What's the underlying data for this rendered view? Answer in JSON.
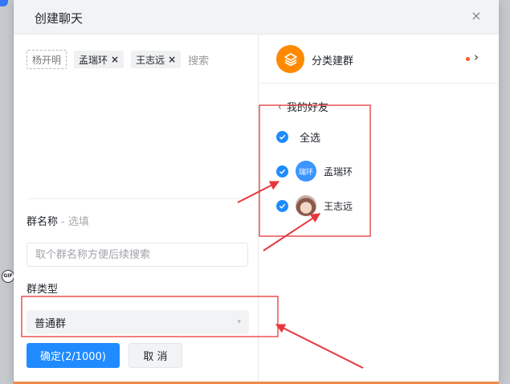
{
  "dialog": {
    "title": "创建聊天",
    "close_label": "×"
  },
  "selected_members": {
    "fixed": "杨开明",
    "chips": [
      {
        "label": "孟瑞环",
        "remove": "×"
      },
      {
        "label": "王志远",
        "remove": "×"
      }
    ],
    "search_placeholder": "搜索"
  },
  "group_name": {
    "label": "群名称",
    "optional": "- 选填",
    "placeholder": "取个群名称方便后续搜索",
    "value": ""
  },
  "group_type": {
    "label": "群类型",
    "selected": "普通群"
  },
  "buttons": {
    "confirm": "确定(2/1000)",
    "cancel": "取 消"
  },
  "right_panel": {
    "category": {
      "label": "分类建群",
      "arrow": "›"
    },
    "back": {
      "chevron": "‹",
      "label": "我的好友"
    },
    "select_all": "全选",
    "friends": [
      {
        "name": "孟瑞环",
        "avatar_text": "瑞环"
      },
      {
        "name": "王志远",
        "avatar_text": ""
      }
    ]
  },
  "background": {
    "gif_badge": "GIF"
  },
  "colors": {
    "accent": "#1f8bff",
    "category_icon": "#ff8a00",
    "annotation": "#e8373a"
  },
  "icons": {
    "category": "layers-icon",
    "check": "check-icon",
    "close": "close-icon"
  }
}
